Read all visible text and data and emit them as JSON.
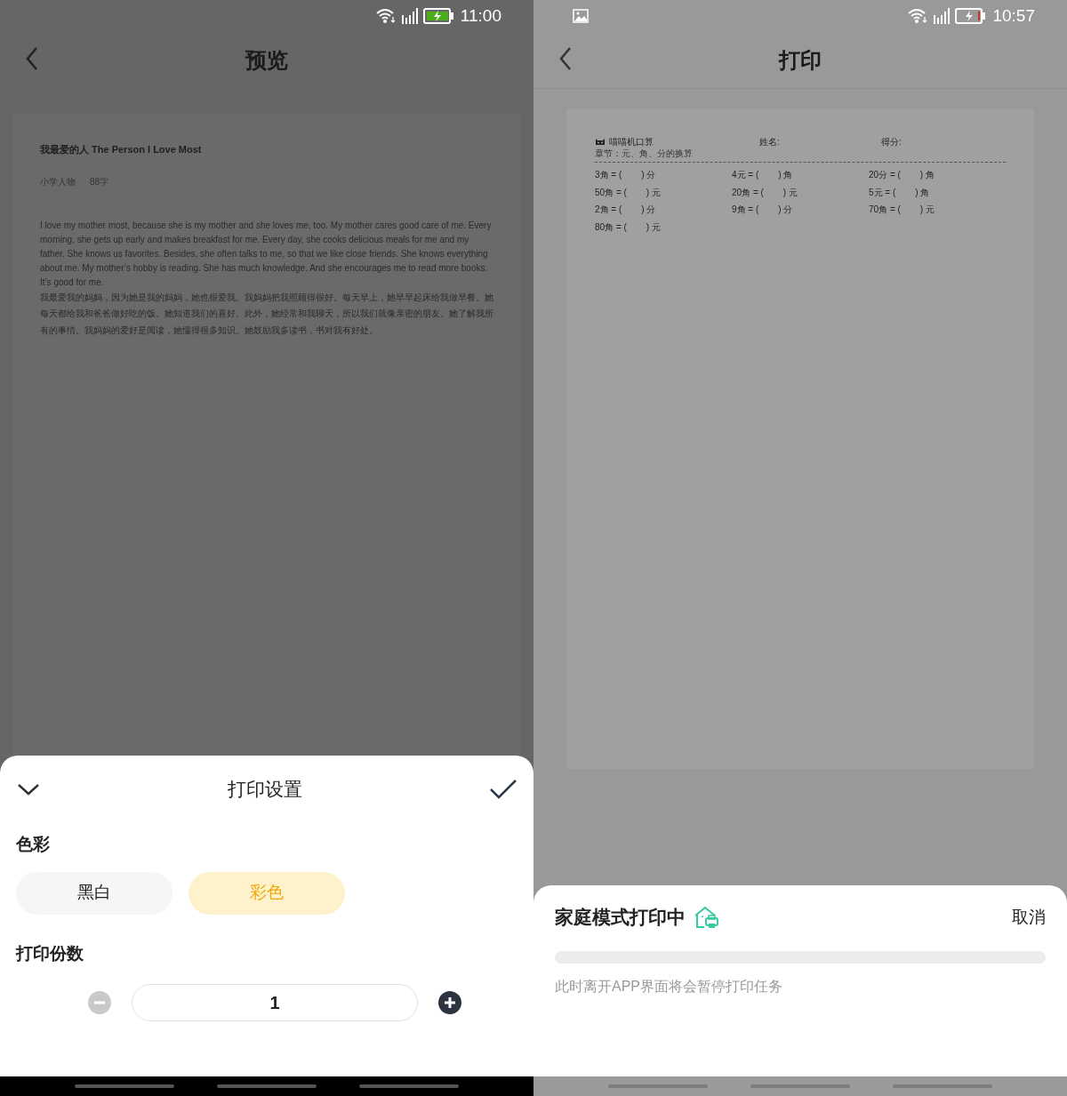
{
  "left": {
    "status_bar": {
      "time": "11:00"
    },
    "header": {
      "title": "预览"
    },
    "document": {
      "title": "我最爱的人 The Person I Love Most",
      "tags": [
        "小学人物",
        "88字"
      ],
      "paragraphs": [
        "I love my mother most, because she is my mother and she loves me, too. My mother cares good care of me. Every morning, she gets up early and makes breakfast for me. Every day, she cooks delicious meals for me and my father. She knows us favorites. Besides, she often talks to me, so that we like close friends. She knows everything about me. My mother’s hobby is reading. She has much knowledge. And she encourages me to read more books. It’s good for me.",
        "我最爱我的妈妈，因为她是我的妈妈，她也很爱我。我妈妈把我照顾得很好。每天早上，她早早起床给我做早餐。她每天都给我和爸爸做好吃的饭。她知道我们的喜好。此外，她经常和我聊天，所以我们就像亲密的朋友。她了解我所有的事情。我妈妈的爱好是阅读，她懂得很多知识。她鼓励我多读书，书对我有好处。"
      ]
    },
    "sheet": {
      "title": "打印设置",
      "color_label": "色彩",
      "color_options": [
        {
          "label": "黑白",
          "selected": false
        },
        {
          "label": "彩色",
          "selected": true
        }
      ],
      "copies_label": "打印份数",
      "copies": "1"
    }
  },
  "right": {
    "status_bar": {
      "time": "10:57"
    },
    "header": {
      "title": "打印"
    },
    "worksheet": {
      "brand": "喵喵机口算",
      "name_label": "姓名:",
      "score_label": "得分:",
      "chapter": "章节：元、角、分的换算",
      "problems": [
        {
          "left": "3角 = (",
          "right": ") 分"
        },
        {
          "left": "4元 = (",
          "right": ") 角"
        },
        {
          "left": "20分 = (",
          "right": ") 角"
        },
        {
          "left": "50角 = (",
          "right": ") 元"
        },
        {
          "left": "20角 = (",
          "right": ") 元"
        },
        {
          "left": "5元 = (",
          "right": ") 角"
        },
        {
          "left": "2角 = (",
          "right": ") 分"
        },
        {
          "left": "9角 = (",
          "right": ") 分"
        },
        {
          "left": "70角 = (",
          "right": ") 元"
        },
        {
          "left": "80角 = (",
          "right": ") 元"
        }
      ]
    },
    "sheet": {
      "title": "家庭模式打印中",
      "cancel": "取消",
      "level": 0,
      "note": "此时离开APP界面将会暂停打印任务"
    }
  }
}
